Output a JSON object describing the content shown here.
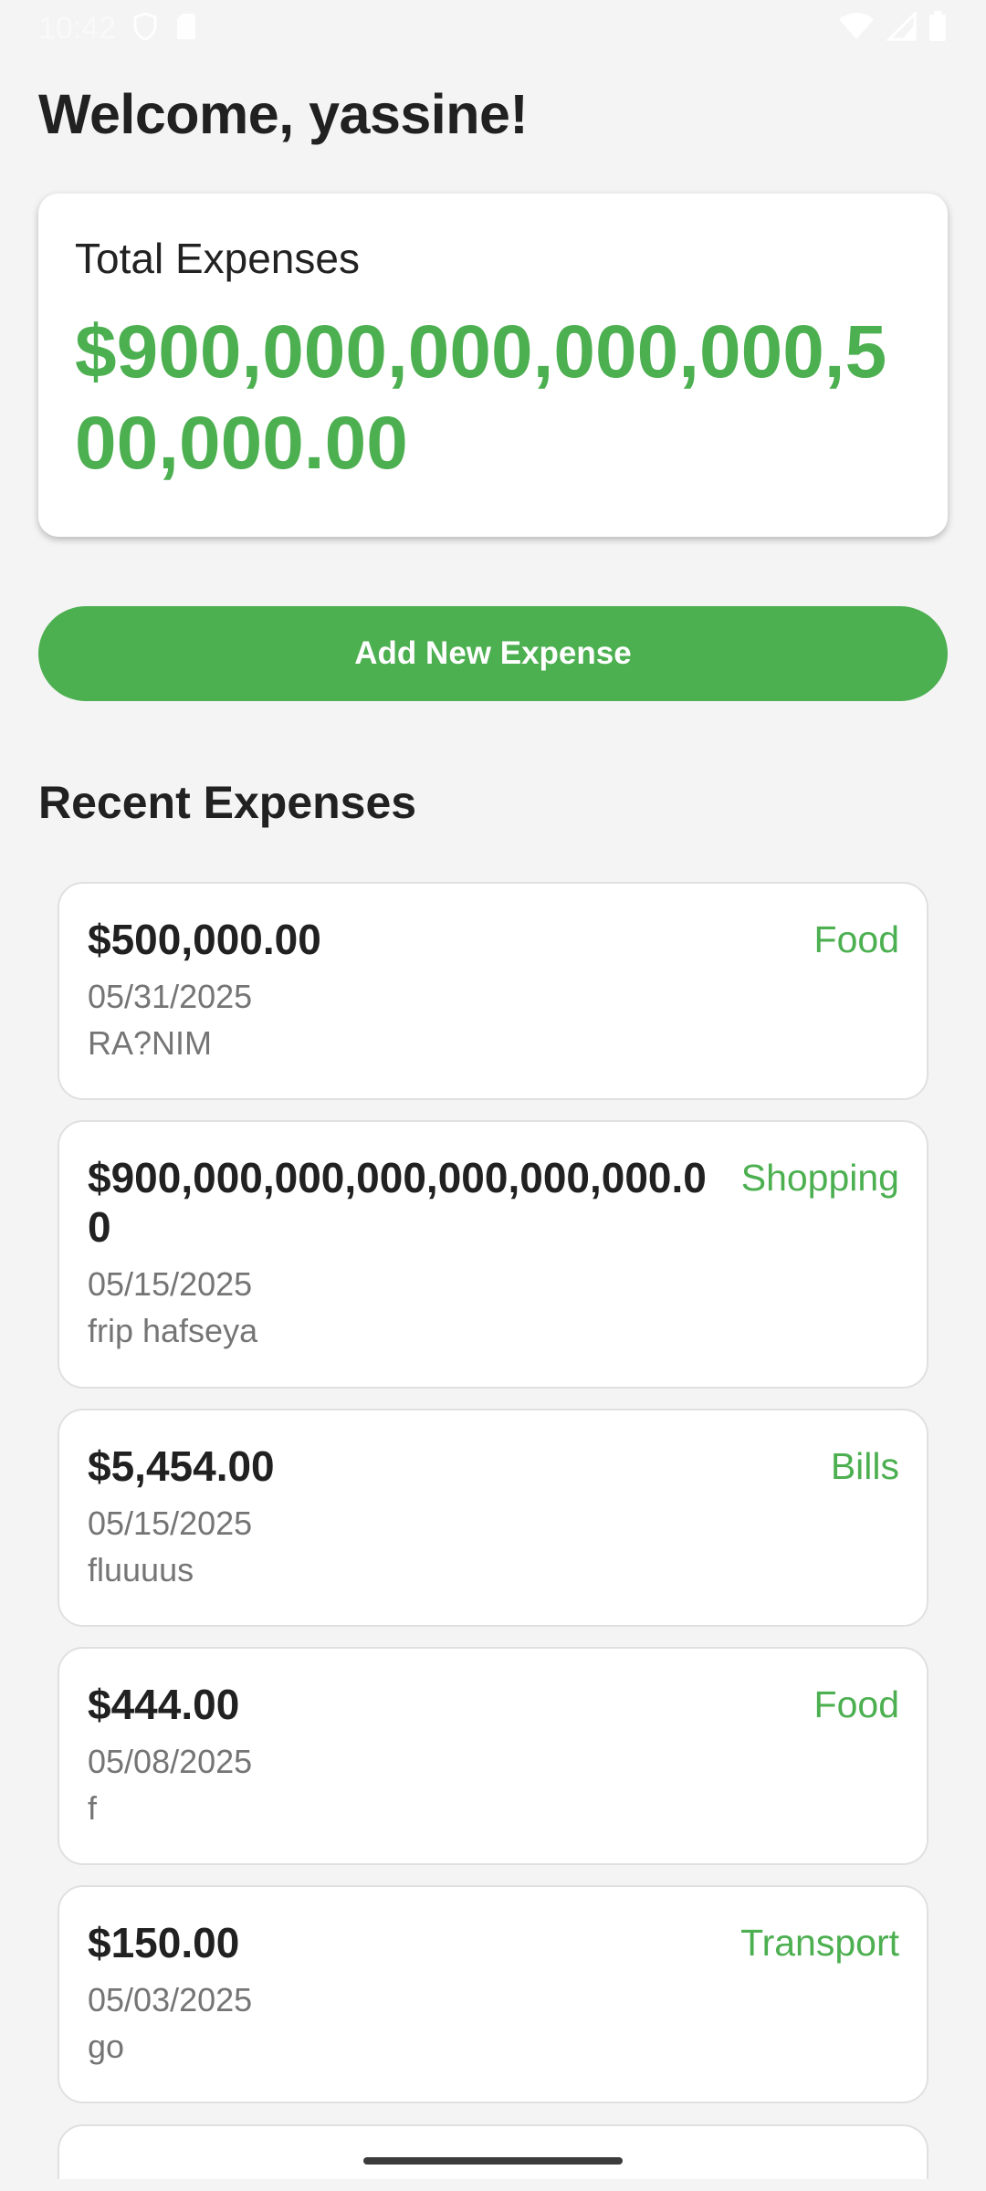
{
  "status_bar": {
    "time": "10:42",
    "icons": [
      "shield-icon",
      "sd-card-icon",
      "wifi-icon",
      "signal-icon",
      "battery-icon"
    ]
  },
  "header": {
    "welcome": "Welcome, yassine!"
  },
  "total_card": {
    "label": "Total Expenses",
    "value": "$900,000,000,000,000,500,000.00"
  },
  "add_button": {
    "label": "Add New Expense"
  },
  "recent": {
    "title": "Recent Expenses",
    "items": [
      {
        "amount": "$500,000.00",
        "category": "Food",
        "date": "05/31/2025",
        "description": "RA?NIM"
      },
      {
        "amount": "$900,000,000,000,000,000,000.00",
        "category": "Shopping",
        "date": "05/15/2025",
        "description": "frip hafseya"
      },
      {
        "amount": "$5,454.00",
        "category": "Bills",
        "date": "05/15/2025",
        "description": "fluuuus"
      },
      {
        "amount": "$444.00",
        "category": "Food",
        "date": "05/08/2025",
        "description": "f"
      },
      {
        "amount": "$150.00",
        "category": "Transport",
        "date": "05/03/2025",
        "description": "go"
      }
    ]
  },
  "colors": {
    "accent": "#4caf50",
    "background": "#f4f4f4",
    "card": "#ffffff",
    "muted_text": "#757575"
  }
}
